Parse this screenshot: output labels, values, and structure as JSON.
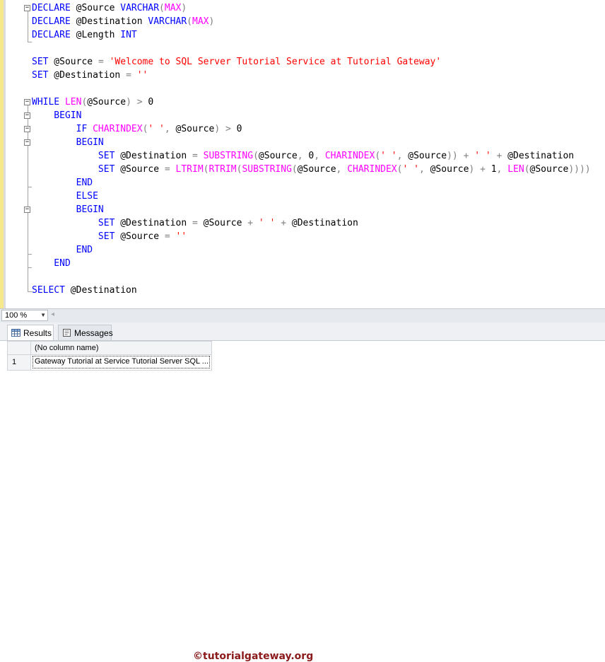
{
  "editor": {
    "lines": [
      [
        {
          "t": "DECLARE",
          "c": "kw"
        },
        {
          "t": " @Source ",
          "c": "id"
        },
        {
          "t": "VARCHAR",
          "c": "kw"
        },
        {
          "t": "(",
          "c": "op"
        },
        {
          "t": "MAX",
          "c": "fn"
        },
        {
          "t": ")",
          "c": "op"
        }
      ],
      [
        {
          "t": "DECLARE",
          "c": "kw"
        },
        {
          "t": " @Destination ",
          "c": "id"
        },
        {
          "t": "VARCHAR",
          "c": "kw"
        },
        {
          "t": "(",
          "c": "op"
        },
        {
          "t": "MAX",
          "c": "fn"
        },
        {
          "t": ")",
          "c": "op"
        }
      ],
      [
        {
          "t": "DECLARE",
          "c": "kw"
        },
        {
          "t": " @Length ",
          "c": "id"
        },
        {
          "t": "INT",
          "c": "kw"
        }
      ],
      [],
      [
        {
          "t": "SET",
          "c": "kw"
        },
        {
          "t": " @Source ",
          "c": "id"
        },
        {
          "t": "=",
          "c": "op"
        },
        {
          "t": " ",
          "c": "id"
        },
        {
          "t": "'Welcome to SQL Server Tutorial Service at Tutorial Gateway'",
          "c": "str"
        }
      ],
      [
        {
          "t": "SET",
          "c": "kw"
        },
        {
          "t": " @Destination ",
          "c": "id"
        },
        {
          "t": "=",
          "c": "op"
        },
        {
          "t": " ",
          "c": "id"
        },
        {
          "t": "''",
          "c": "str"
        }
      ],
      [],
      [
        {
          "t": "WHILE",
          "c": "kw"
        },
        {
          "t": " ",
          "c": "id"
        },
        {
          "t": "LEN",
          "c": "fn"
        },
        {
          "t": "(",
          "c": "op"
        },
        {
          "t": "@Source",
          "c": "id"
        },
        {
          "t": ")",
          "c": "op"
        },
        {
          "t": " ",
          "c": "id"
        },
        {
          "t": ">",
          "c": "op"
        },
        {
          "t": " 0",
          "c": "id"
        }
      ],
      [
        {
          "t": "    BEGIN",
          "c": "kw"
        }
      ],
      [
        {
          "t": "        IF",
          "c": "kw"
        },
        {
          "t": " ",
          "c": "id"
        },
        {
          "t": "CHARINDEX",
          "c": "fn"
        },
        {
          "t": "(",
          "c": "op"
        },
        {
          "t": "' '",
          "c": "str"
        },
        {
          "t": ",",
          "c": "op"
        },
        {
          "t": " @Source",
          "c": "id"
        },
        {
          "t": ")",
          "c": "op"
        },
        {
          "t": " ",
          "c": "id"
        },
        {
          "t": ">",
          "c": "op"
        },
        {
          "t": " 0",
          "c": "id"
        }
      ],
      [
        {
          "t": "        BEGIN",
          "c": "kw"
        }
      ],
      [
        {
          "t": "            SET",
          "c": "kw"
        },
        {
          "t": " @Destination ",
          "c": "id"
        },
        {
          "t": "=",
          "c": "op"
        },
        {
          "t": " ",
          "c": "id"
        },
        {
          "t": "SUBSTRING",
          "c": "fn"
        },
        {
          "t": "(",
          "c": "op"
        },
        {
          "t": "@Source",
          "c": "id"
        },
        {
          "t": ",",
          "c": "op"
        },
        {
          "t": " 0",
          "c": "id"
        },
        {
          "t": ",",
          "c": "op"
        },
        {
          "t": " ",
          "c": "id"
        },
        {
          "t": "CHARINDEX",
          "c": "fn"
        },
        {
          "t": "(",
          "c": "op"
        },
        {
          "t": "' '",
          "c": "str"
        },
        {
          "t": ",",
          "c": "op"
        },
        {
          "t": " @Source",
          "c": "id"
        },
        {
          "t": "))",
          "c": "op"
        },
        {
          "t": " ",
          "c": "id"
        },
        {
          "t": "+",
          "c": "op"
        },
        {
          "t": " ",
          "c": "id"
        },
        {
          "t": "' '",
          "c": "str"
        },
        {
          "t": " ",
          "c": "id"
        },
        {
          "t": "+",
          "c": "op"
        },
        {
          "t": " @Destination",
          "c": "id"
        }
      ],
      [
        {
          "t": "            SET",
          "c": "kw"
        },
        {
          "t": " @Source ",
          "c": "id"
        },
        {
          "t": "=",
          "c": "op"
        },
        {
          "t": " ",
          "c": "id"
        },
        {
          "t": "LTRIM",
          "c": "fn"
        },
        {
          "t": "(",
          "c": "op"
        },
        {
          "t": "RTRIM",
          "c": "fn"
        },
        {
          "t": "(",
          "c": "op"
        },
        {
          "t": "SUBSTRING",
          "c": "fn"
        },
        {
          "t": "(",
          "c": "op"
        },
        {
          "t": "@Source",
          "c": "id"
        },
        {
          "t": ",",
          "c": "op"
        },
        {
          "t": " ",
          "c": "id"
        },
        {
          "t": "CHARINDEX",
          "c": "fn"
        },
        {
          "t": "(",
          "c": "op"
        },
        {
          "t": "' '",
          "c": "str"
        },
        {
          "t": ",",
          "c": "op"
        },
        {
          "t": " @Source",
          "c": "id"
        },
        {
          "t": ")",
          "c": "op"
        },
        {
          "t": " ",
          "c": "id"
        },
        {
          "t": "+",
          "c": "op"
        },
        {
          "t": " 1",
          "c": "id"
        },
        {
          "t": ",",
          "c": "op"
        },
        {
          "t": " ",
          "c": "id"
        },
        {
          "t": "LEN",
          "c": "fn"
        },
        {
          "t": "(",
          "c": "op"
        },
        {
          "t": "@Source",
          "c": "id"
        },
        {
          "t": "))))",
          "c": "op"
        }
      ],
      [
        {
          "t": "        END",
          "c": "kw"
        }
      ],
      [
        {
          "t": "        ELSE",
          "c": "kw"
        }
      ],
      [
        {
          "t": "        BEGIN",
          "c": "kw"
        }
      ],
      [
        {
          "t": "            SET",
          "c": "kw"
        },
        {
          "t": " @Destination ",
          "c": "id"
        },
        {
          "t": "=",
          "c": "op"
        },
        {
          "t": " @Source ",
          "c": "id"
        },
        {
          "t": "+",
          "c": "op"
        },
        {
          "t": " ",
          "c": "id"
        },
        {
          "t": "' '",
          "c": "str"
        },
        {
          "t": " ",
          "c": "id"
        },
        {
          "t": "+",
          "c": "op"
        },
        {
          "t": " @Destination",
          "c": "id"
        }
      ],
      [
        {
          "t": "            SET",
          "c": "kw"
        },
        {
          "t": " @Source ",
          "c": "id"
        },
        {
          "t": "=",
          "c": "op"
        },
        {
          "t": " ",
          "c": "id"
        },
        {
          "t": "''",
          "c": "str"
        }
      ],
      [
        {
          "t": "        END",
          "c": "kw"
        }
      ],
      [
        {
          "t": "    END",
          "c": "kw"
        }
      ],
      [],
      [
        {
          "t": "SELECT",
          "c": "kw"
        },
        {
          "t": " @Destination",
          "c": "id"
        }
      ]
    ]
  },
  "statusbar": {
    "zoom": "100 %"
  },
  "results": {
    "tabs": [
      {
        "label": "Results"
      },
      {
        "label": "Messages"
      }
    ],
    "watermark": "©tutorialgateway.org",
    "column_header": "(No column name)",
    "row_number": "1",
    "cell_value": "Gateway Tutorial at Service Tutorial Server SQL ..."
  }
}
